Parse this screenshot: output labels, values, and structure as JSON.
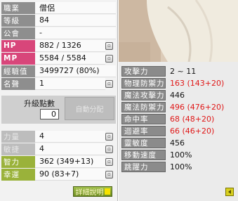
{
  "stats_left": [
    {
      "label": "職業",
      "value": "僧侶",
      "style": "gray"
    },
    {
      "label": "等級",
      "value": "84",
      "style": "gray"
    },
    {
      "label": "公會",
      "value": "-",
      "style": "gray"
    },
    {
      "label": "HP",
      "value": "882 / 1326",
      "style": "pink",
      "has_button": true
    },
    {
      "label": "MP",
      "value": "5584 / 5584",
      "style": "pink",
      "has_button": true
    },
    {
      "label": "經驗值",
      "value": "3499727 (80%)",
      "style": "gray"
    },
    {
      "label": "名聲",
      "value": "1",
      "style": "gray",
      "has_button": true
    }
  ],
  "ap": {
    "title": "升級點數",
    "value": "0",
    "auto_label": "自動分配"
  },
  "stats_primary": [
    {
      "label": "力量",
      "value": "4",
      "style": "light",
      "has_button": true
    },
    {
      "label": "敏捷",
      "value": "4",
      "style": "light",
      "has_button": true
    },
    {
      "label": "智力",
      "value": "362 (349+13)",
      "style": "green",
      "has_button": true
    },
    {
      "label": "幸運",
      "value": "90 (83+7)",
      "style": "green",
      "has_button": true
    }
  ],
  "detail_button": "詳細說明",
  "stats_right": [
    {
      "label": "攻擊力",
      "value": "2 ~ 11",
      "red": false
    },
    {
      "label": "物理防禦力",
      "value": "163 (143+20)",
      "red": true
    },
    {
      "label": "魔法攻擊力",
      "value": "446",
      "red": false
    },
    {
      "label": "魔法防禦力",
      "value": "496 (476+20)",
      "red": true
    },
    {
      "label": "命中率",
      "value": "68 (48+20)",
      "red": true
    },
    {
      "label": "迴避率",
      "value": "66 (46+20)",
      "red": true
    },
    {
      "label": "靈敏度",
      "value": "456",
      "red": false
    },
    {
      "label": "移動速度",
      "value": "100%",
      "red": false
    },
    {
      "label": "跳躍力",
      "value": "100%",
      "red": false
    }
  ],
  "icons": {
    "stat_button": "square-button-icon",
    "collapse": "arrow-left-icon"
  }
}
